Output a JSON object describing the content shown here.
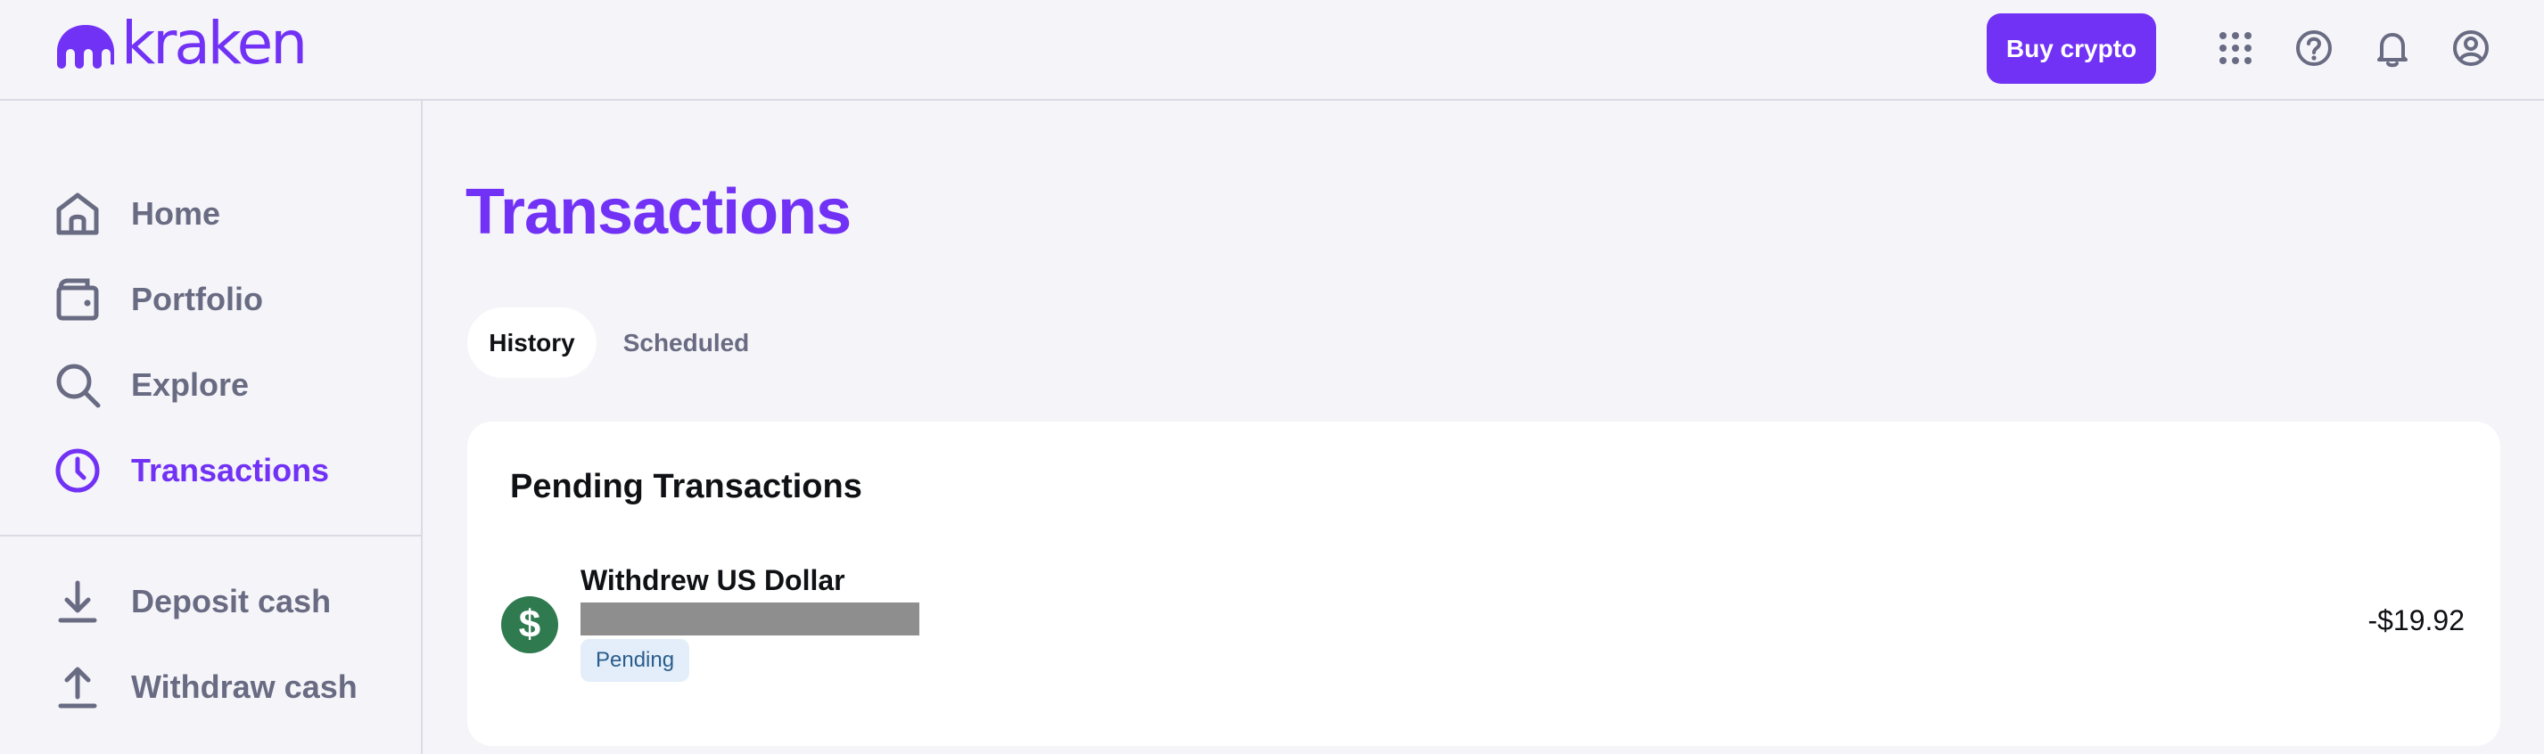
{
  "brand": {
    "name": "kraken",
    "color": "#7132f5"
  },
  "header": {
    "buy_label": "Buy crypto",
    "icons": [
      "apps-grid-icon",
      "help-icon",
      "bell-icon",
      "account-icon"
    ]
  },
  "sidebar": {
    "items": [
      {
        "label": "Home",
        "icon": "home-icon",
        "active": false
      },
      {
        "label": "Portfolio",
        "icon": "wallet-icon",
        "active": false
      },
      {
        "label": "Explore",
        "icon": "search-icon",
        "active": false
      },
      {
        "label": "Transactions",
        "icon": "clock-icon",
        "active": true
      },
      {
        "label": "Deposit cash",
        "icon": "download-icon",
        "active": false
      },
      {
        "label": "Withdraw cash",
        "icon": "upload-icon",
        "active": false
      }
    ]
  },
  "main": {
    "title": "Transactions",
    "tabs": [
      {
        "label": "History",
        "active": true
      },
      {
        "label": "Scheduled",
        "active": false
      }
    ],
    "pending": {
      "title": "Pending Transactions",
      "transactions": [
        {
          "title": "Withdrew US Dollar",
          "icon": "dollar-icon",
          "status": "Pending",
          "amount": "-$19.92"
        }
      ]
    }
  }
}
